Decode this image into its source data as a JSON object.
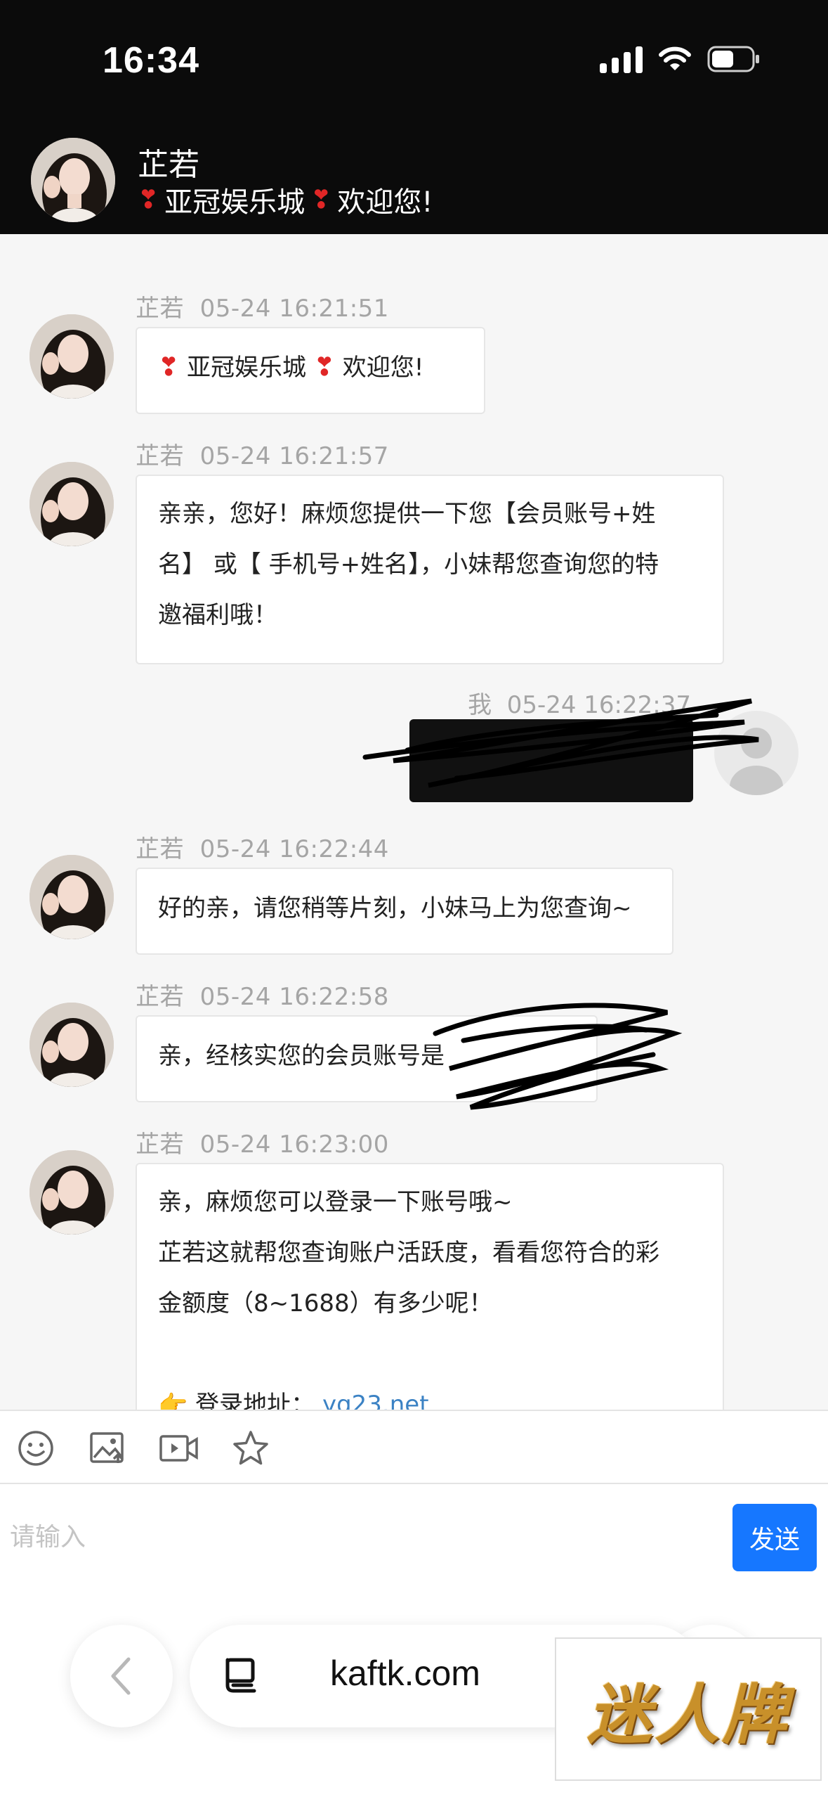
{
  "status": {
    "time": "16:34"
  },
  "header": {
    "agent_name": "芷若",
    "subtitle": "亚冠娱乐城",
    "subtitle_suffix": "欢迎您!"
  },
  "messages": [
    {
      "sender": "芷若",
      "time": "05-24 16:21:51",
      "lines": [
        "亚冠娱乐城",
        "欢迎您!"
      ]
    },
    {
      "sender": "芷若",
      "time": "05-24 16:21:57",
      "lines": [
        "亲亲，您好！麻烦您提供一下您【会员账号+姓",
        "名】 或【 手机号+姓名】，小妹帮您查询您的特",
        "邀福利哦！"
      ]
    },
    {
      "sender": "我",
      "time": "05-24 16:22:37",
      "lines": []
    },
    {
      "sender": "芷若",
      "time": "05-24 16:22:44",
      "lines": [
        "好的亲，请您稍等片刻，小妹马上为您查询~"
      ]
    },
    {
      "sender": "芷若",
      "time": "05-24 16:22:58",
      "lines": [
        "亲，经核实您的会员账号是"
      ]
    },
    {
      "sender": "芷若",
      "time": "05-24 16:23:00",
      "lines": [
        "亲，麻烦您可以登录一下账号哦~",
        "芷若这就帮您查询账户活跃度，看看您符合的彩",
        "金额度（8~1688）有多少呢！"
      ],
      "link_label": "登录地址：",
      "link_text": "yg23.net"
    }
  ],
  "composer": {
    "placeholder": "请输入",
    "send_label": "发送"
  },
  "browser": {
    "url": "kaftk.com"
  },
  "watermark": {
    "text": "迷人牌"
  },
  "icons": {
    "toolbar": [
      "emoji-icon",
      "image-upload-icon",
      "video-icon",
      "star-icon"
    ],
    "heart": "heart-exclamation-icon",
    "pointer": "pointing-hand-icon"
  },
  "colors": {
    "accent": "#1677ff",
    "link": "#3b82c4",
    "heart": "#e02626",
    "header_bg": "#0b0b0b"
  }
}
